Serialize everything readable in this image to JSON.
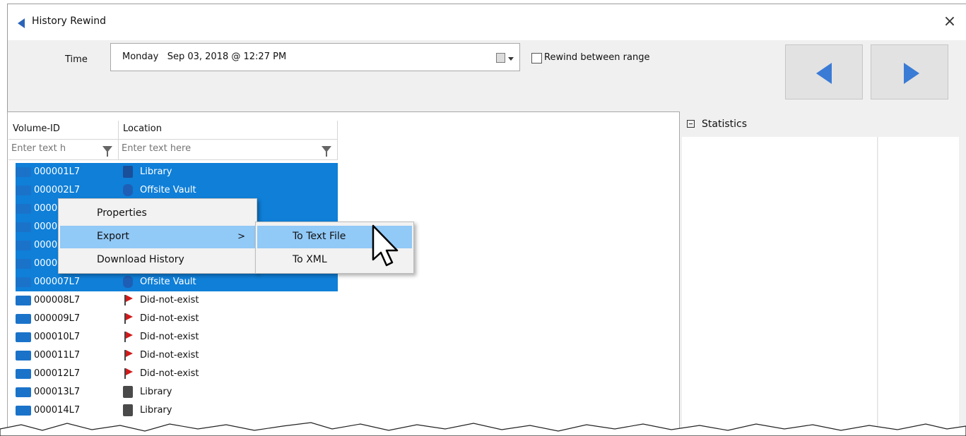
{
  "window": {
    "title": "History Rewind",
    "close_glyph": "×",
    "back_icon": "back-triangle-icon"
  },
  "toolbar": {
    "time_label": "Time",
    "time_value": "Monday   Sep 03, 2018 @ 12:27 PM",
    "rewind_between_range_label": "Rewind between range",
    "rewind_between_range_checked": false
  },
  "grid": {
    "columns": [
      "Volume-ID",
      "Location"
    ],
    "filter_placeholders": [
      "Enter text h",
      "Enter text here"
    ],
    "rows": [
      {
        "volume_id": "000001L7",
        "location": "Library",
        "location_icon": "library",
        "selected": true
      },
      {
        "volume_id": "000002L7",
        "location": "Offsite Vault",
        "location_icon": "vault",
        "selected": true
      },
      {
        "volume_id": "000003L7",
        "location": "",
        "location_icon": "library",
        "selected": true
      },
      {
        "volume_id": "000004L7",
        "location": "",
        "location_icon": "library",
        "selected": true
      },
      {
        "volume_id": "000005L7",
        "location": "",
        "location_icon": "library",
        "selected": true
      },
      {
        "volume_id": "000006L7",
        "location": "",
        "location_icon": "library",
        "selected": true
      },
      {
        "volume_id": "000007L7",
        "location": "Offsite Vault",
        "location_icon": "vault",
        "selected": true
      },
      {
        "volume_id": "000008L7",
        "location": "Did-not-exist",
        "location_icon": "flag",
        "selected": false
      },
      {
        "volume_id": "000009L7",
        "location": "Did-not-exist",
        "location_icon": "flag",
        "selected": false
      },
      {
        "volume_id": "000010L7",
        "location": "Did-not-exist",
        "location_icon": "flag",
        "selected": false
      },
      {
        "volume_id": "000011L7",
        "location": "Did-not-exist",
        "location_icon": "flag",
        "selected": false
      },
      {
        "volume_id": "000012L7",
        "location": "Did-not-exist",
        "location_icon": "flag",
        "selected": false
      },
      {
        "volume_id": "000013L7",
        "location": "Library",
        "location_icon": "library",
        "selected": false
      },
      {
        "volume_id": "000014L7",
        "location": "Library",
        "location_icon": "library",
        "selected": false
      }
    ]
  },
  "statistics": {
    "header": "Statistics"
  },
  "context_menu": {
    "items": [
      "Properties",
      "Export",
      "Download History"
    ],
    "highlighted": "Export",
    "submenu_arrow": ">"
  },
  "export_submenu": {
    "items": [
      "To Text File",
      "To XML"
    ],
    "highlighted": "To Text File"
  },
  "colors": {
    "selection": "#0f7fd8",
    "menu_highlight": "#91c9f7",
    "nav_arrow": "#3a7bd5"
  }
}
